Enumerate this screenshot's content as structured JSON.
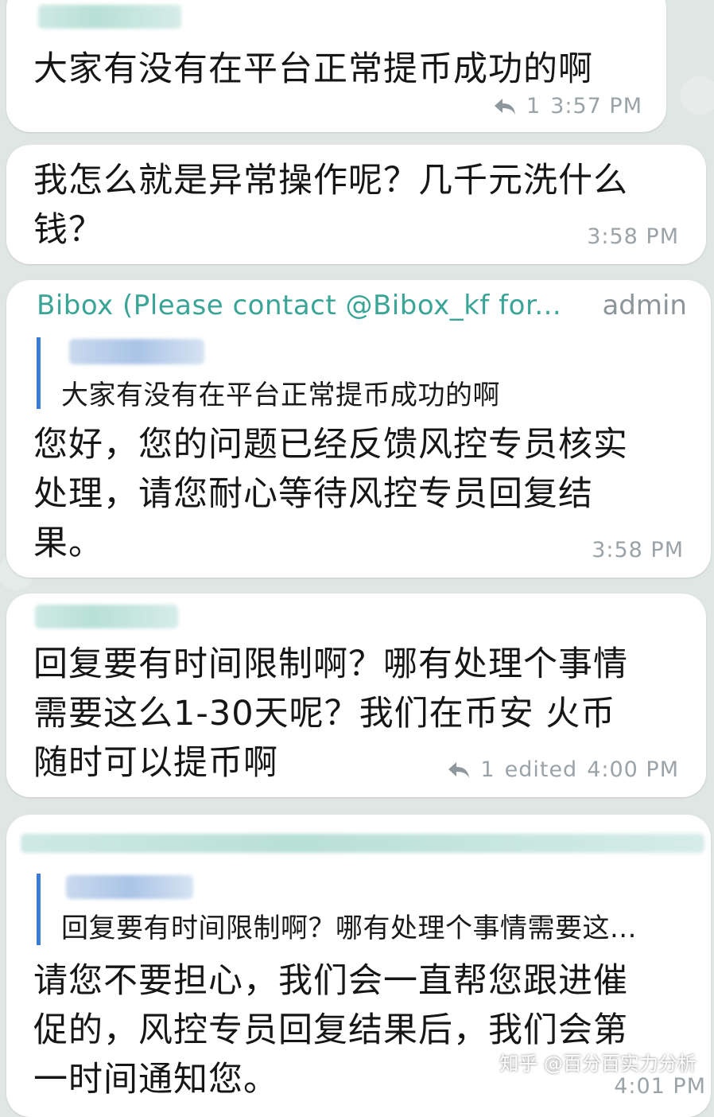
{
  "messages": [
    {
      "text": "大家有没有在平台正常提币成功的啊",
      "reply_count": "1",
      "time": "3:57 PM"
    },
    {
      "text": "我怎么就是异常操作呢？几千元洗什么\n钱？",
      "time": "3:58 PM"
    },
    {
      "sender": "Bibox (Please contact @Bibox_kf for...",
      "role": "admin",
      "quote_text": "大家有没有在平台正常提币成功的啊",
      "text": "您好，您的问题已经反馈风控专员核实\n处理，请您耐心等待风控专员回复结\n果。",
      "time": "3:58 PM"
    },
    {
      "text": "回复要有时间限制啊？哪有处理个事情\n需要这么1-30天呢？我们在币安 火币\n随时可以提币啊",
      "reply_count": "1",
      "edited_label": "edited",
      "time": "4:00 PM"
    },
    {
      "quote_text": "回复要有时间限制啊？哪有处理个事情需要这...",
      "text": "请您不要担心，我们会一直帮您跟进催\n促的，风控专员回复结果后，我们会第\n一时间通知您。",
      "time": "4:01 PM"
    }
  ],
  "watermark": "知乎 @百分百实力分析",
  "colors": {
    "sender": "#3aa597",
    "quote_bar": "#3a7bd5",
    "meta": "#9aa3a8",
    "background": "#dfe6e3"
  },
  "icons": {
    "reply": "reply-arrow-icon"
  }
}
